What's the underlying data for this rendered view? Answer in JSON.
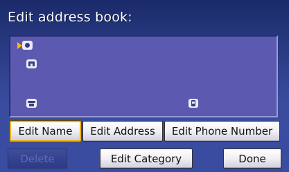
{
  "screen": {
    "title": "Edit address book:"
  },
  "entry_icons": [
    "name-icon",
    "home-icon",
    "home-phone-icon",
    "cell-phone-icon"
  ],
  "buttons": {
    "edit_name": "Edit Name",
    "edit_address": "Edit Address",
    "edit_phone": "Edit Phone Number",
    "delete": "Delete",
    "edit_category": "Edit Category",
    "done": "Done"
  },
  "colors": {
    "background": "#3a4c9e",
    "panel": "#5b5ab0",
    "selection_border": "#f2b000",
    "pointer": "#ffb400"
  }
}
